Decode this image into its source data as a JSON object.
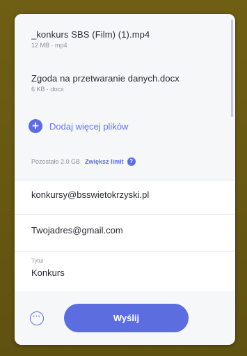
{
  "files": [
    {
      "name": "_konkurs SBS (Film) (1).mp4",
      "meta": "12 MB · mp4"
    },
    {
      "name": "Zgoda na przetwaranie danych.docx",
      "meta": "6 KB · docx"
    }
  ],
  "add_more": {
    "icon": "plus-icon",
    "label": "Dodaj więcej plików"
  },
  "limit": {
    "text": "Pozostało 2.0 GB",
    "link": "Zwiększ limit",
    "info_icon": "info-icon"
  },
  "recipient": {
    "value": "konkursy@bsswietokrzyski.pl"
  },
  "sender": {
    "value": "Twojadres@gmail.com"
  },
  "title_field": {
    "label": "Tytuł",
    "value": "Konkurs"
  },
  "actions": {
    "more_icon": "ellipsis-icon",
    "send_label": "Wyślij"
  },
  "colors": {
    "accent": "#5c6de0",
    "background": "#6b5a12",
    "panel": "#ffffff",
    "files_area": "#f6f7f9"
  }
}
